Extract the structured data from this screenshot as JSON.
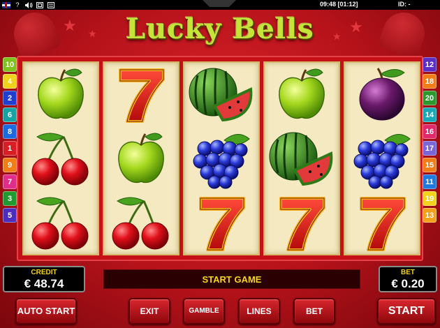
{
  "topbar": {
    "icons": [
      "flag-uk-icon",
      "help-icon",
      "sound-icon",
      "fullscreen-icon",
      "settings-icon"
    ],
    "help_label": "?",
    "clock": "09:48 [01:12]",
    "id_label": "ID: -"
  },
  "game": {
    "title": "Lucky Bells"
  },
  "reels": [
    [
      "apple",
      "cherries",
      "cherries"
    ],
    [
      "seven",
      "apple",
      "cherries"
    ],
    [
      "watermelon",
      "grapes",
      "seven"
    ],
    [
      "apple",
      "watermelon",
      "seven"
    ],
    [
      "plum",
      "grapes",
      "seven"
    ]
  ],
  "left_lines": [
    {
      "n": "10",
      "color": "#7ec21e"
    },
    {
      "n": "4",
      "color": "#f0d21a"
    },
    {
      "n": "2",
      "color": "#1f3fd0"
    },
    {
      "n": "6",
      "color": "#15a3a3"
    },
    {
      "n": "8",
      "color": "#1a6ae0"
    },
    {
      "n": "1",
      "color": "#d81d24"
    },
    {
      "n": "9",
      "color": "#f07d16"
    },
    {
      "n": "7",
      "color": "#e12d8a"
    },
    {
      "n": "3",
      "color": "#1e9a2e"
    },
    {
      "n": "5",
      "color": "#4b2ec0"
    }
  ],
  "right_lines": [
    {
      "n": "12",
      "color": "#5b2fc4"
    },
    {
      "n": "18",
      "color": "#f07d16"
    },
    {
      "n": "20",
      "color": "#2a9a2e"
    },
    {
      "n": "14",
      "color": "#18a9b8"
    },
    {
      "n": "16",
      "color": "#e0286a"
    },
    {
      "n": "17",
      "color": "#7a66d8"
    },
    {
      "n": "15",
      "color": "#f07d16"
    },
    {
      "n": "11",
      "color": "#1f7ae0"
    },
    {
      "n": "19",
      "color": "#f3d21a"
    },
    {
      "n": "13",
      "color": "#f2a21a"
    }
  ],
  "panel": {
    "credit_label": "CREDIT",
    "credit_value": "€ 48.74",
    "message": "START GAME",
    "bet_label": "BET",
    "bet_value": "€ 0.20"
  },
  "buttons": {
    "auto_start": "AUTO START",
    "exit": "EXIT",
    "gamble": "GAMBLE",
    "lines": "LINES",
    "bet": "BET",
    "start": "START"
  }
}
